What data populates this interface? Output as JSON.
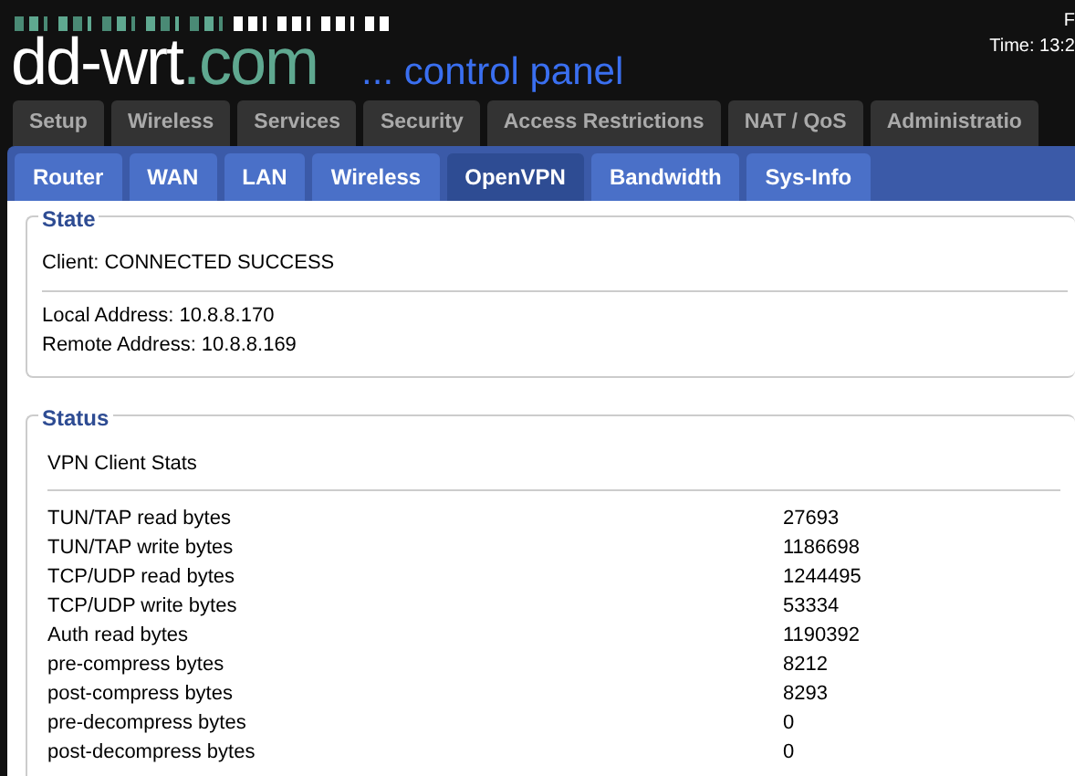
{
  "header": {
    "logo_main": "dd-wrt",
    "logo_domain": ".com",
    "tagline": "... control panel",
    "corner_line_1": "F",
    "corner_line_2": "Time: 13:2"
  },
  "main_tabs": [
    {
      "label": "Setup",
      "selected": false
    },
    {
      "label": "Wireless",
      "selected": false
    },
    {
      "label": "Services",
      "selected": false
    },
    {
      "label": "Security",
      "selected": false
    },
    {
      "label": "Access Restrictions",
      "selected": false
    },
    {
      "label": "NAT / QoS",
      "selected": false
    },
    {
      "label": "Administratio",
      "selected": false
    }
  ],
  "sub_tabs": [
    {
      "label": "Router",
      "selected": false
    },
    {
      "label": "WAN",
      "selected": false
    },
    {
      "label": "LAN",
      "selected": false
    },
    {
      "label": "Wireless",
      "selected": false
    },
    {
      "label": "OpenVPN",
      "selected": true
    },
    {
      "label": "Bandwidth",
      "selected": false
    },
    {
      "label": "Sys-Info",
      "selected": false
    }
  ],
  "state": {
    "legend": "State",
    "client": "Client: CONNECTED SUCCESS",
    "local_address": "Local Address: 10.8.8.170",
    "remote_address": "Remote Address: 10.8.8.169"
  },
  "status": {
    "legend": "Status",
    "heading": "VPN Client Stats",
    "rows": [
      {
        "label": "TUN/TAP read bytes",
        "value": "27693"
      },
      {
        "label": "TUN/TAP write bytes",
        "value": "1186698"
      },
      {
        "label": "TCP/UDP read bytes",
        "value": "1244495"
      },
      {
        "label": "TCP/UDP write bytes",
        "value": "53334"
      },
      {
        "label": "Auth read bytes",
        "value": "1190392"
      },
      {
        "label": "pre-compress bytes",
        "value": "8212"
      },
      {
        "label": "post-compress bytes",
        "value": "8293"
      },
      {
        "label": "pre-decompress bytes",
        "value": "0"
      },
      {
        "label": "post-decompress bytes",
        "value": "0"
      }
    ]
  }
}
